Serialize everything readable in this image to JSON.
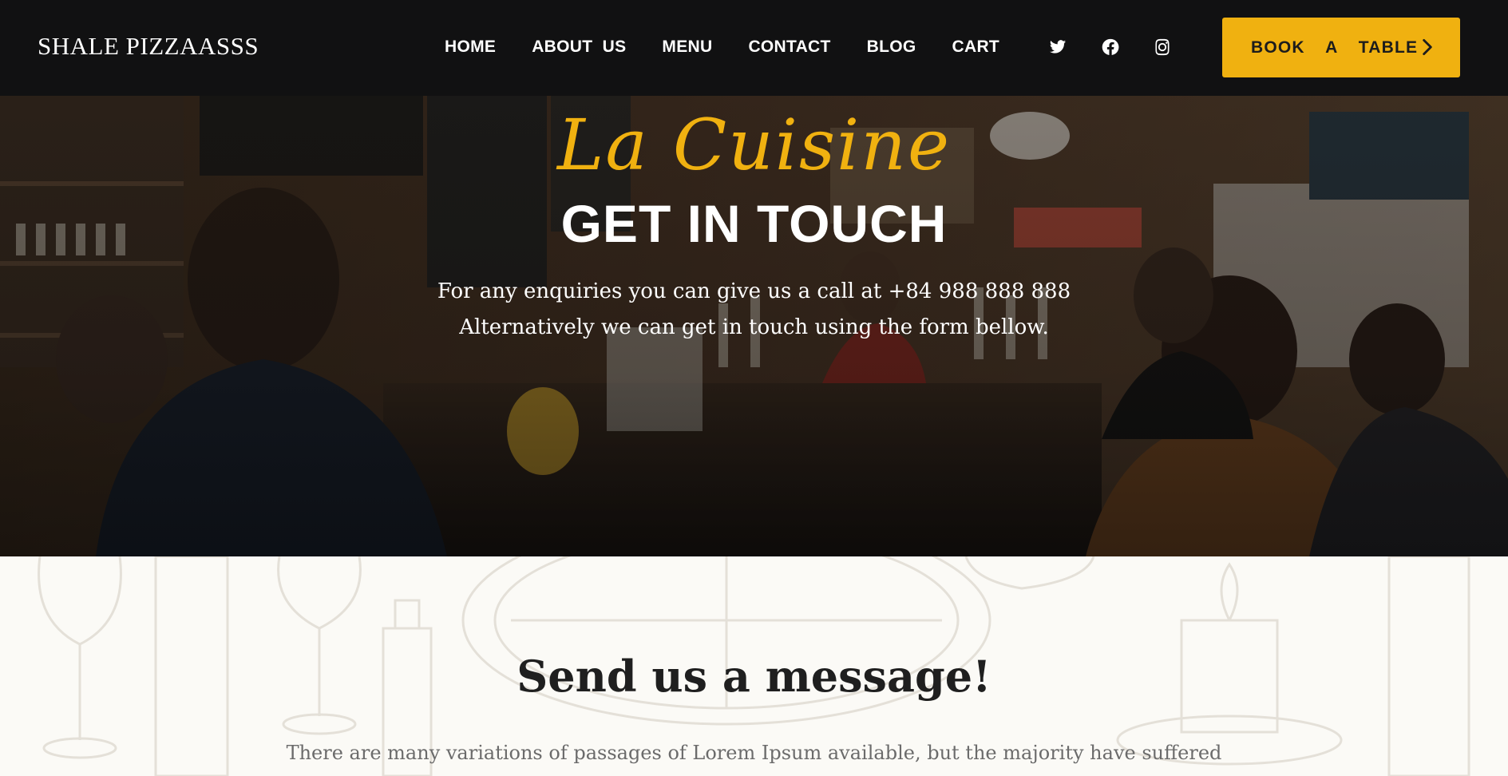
{
  "navbar": {
    "brand": "SHALE PIZZAASSS",
    "links": [
      "HOME",
      "ABOUT  US",
      "MENU",
      "CONTACT",
      "BLOG",
      "CART"
    ],
    "social_icons": [
      "twitter-icon",
      "facebook-icon",
      "instagram-icon"
    ],
    "book_button": "BOOK  A  TABLE",
    "book_icon": "chevron-right-icon"
  },
  "hero": {
    "script_title": "La Cuisine",
    "title": "GET IN TOUCH",
    "line1": "For any enquiries you can give us a call at +84 988 888 888",
    "line2": "Alternatively we can get in touch using the form bellow."
  },
  "message": {
    "title": "Send us a message!",
    "text": "There are many variations of passages of Lorem Ipsum available, but the majority have suffered"
  },
  "colors": {
    "navbar_bg": "#111112",
    "accent": "#f0b110",
    "section_bg": "#fbfaf6"
  }
}
